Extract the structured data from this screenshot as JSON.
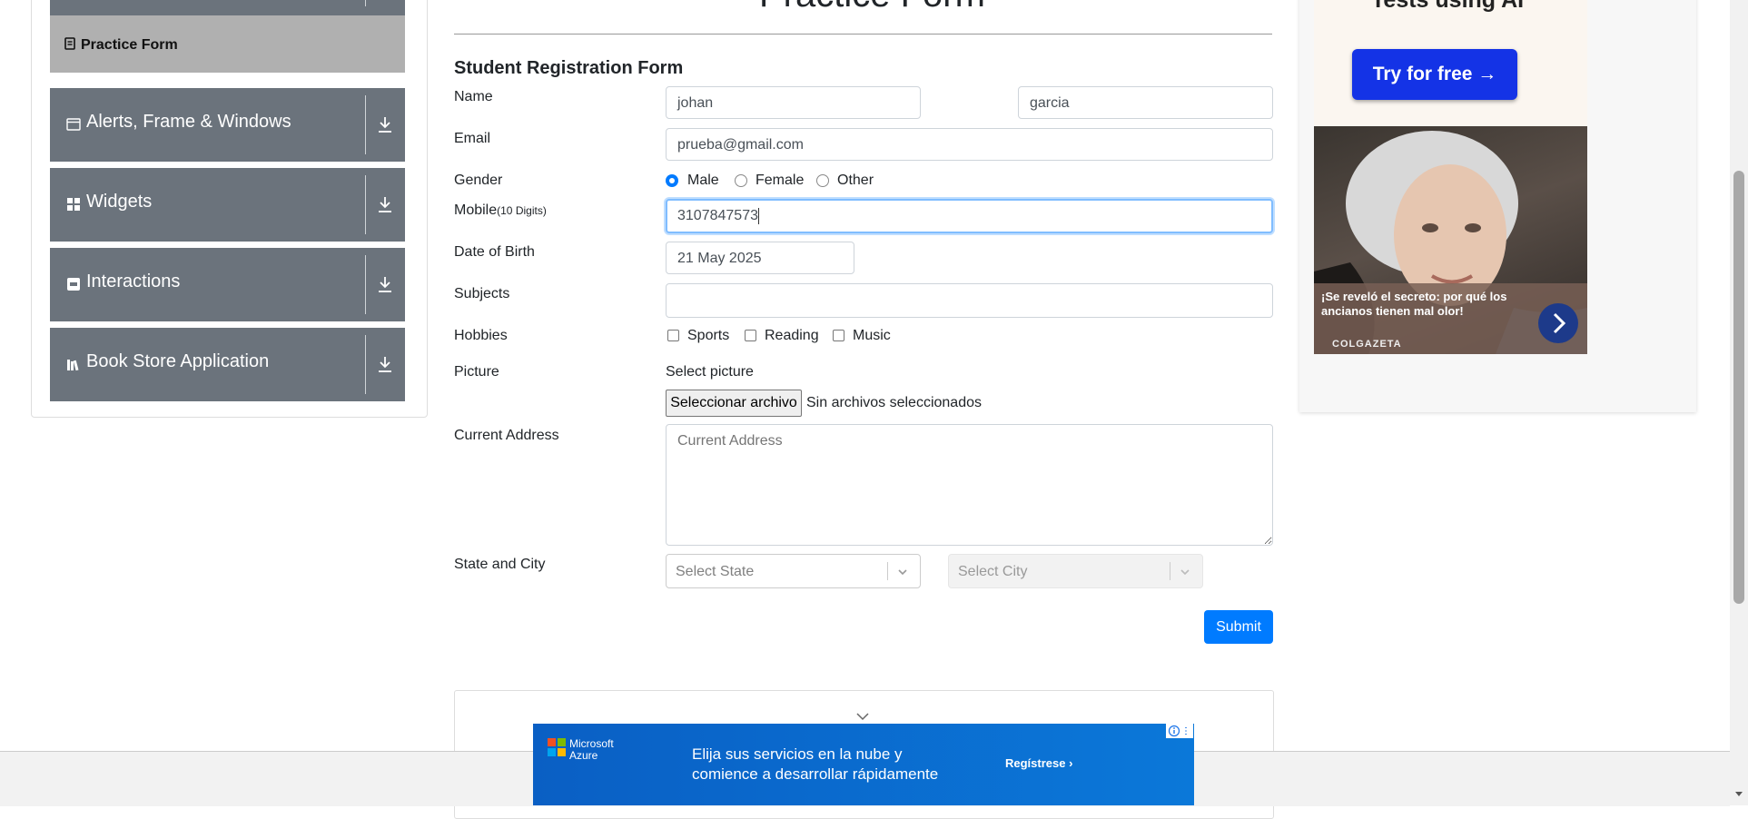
{
  "page": {
    "heading": "Practice Form"
  },
  "sidebar": {
    "active_item": "Practice Form",
    "groups": [
      {
        "label": "Alerts, Frame & Windows",
        "icon": "window-icon"
      },
      {
        "label": "Widgets",
        "icon": "widgets-icon"
      },
      {
        "label": "Interactions",
        "icon": "interactions-icon"
      },
      {
        "label": "Book Store Application",
        "icon": "books-icon"
      }
    ]
  },
  "form": {
    "title": "Student Registration Form",
    "labels": {
      "name": "Name",
      "email": "Email",
      "gender": "Gender",
      "mobile": "Mobile",
      "mobile_hint": "(10 Digits)",
      "dob": "Date of Birth",
      "subjects": "Subjects",
      "hobbies": "Hobbies",
      "picture": "Picture",
      "address": "Current Address",
      "state_city": "State and City"
    },
    "first_name": "johan",
    "last_name": "garcia",
    "email": "prueba@gmail.com",
    "gender_options": [
      "Male",
      "Female",
      "Other"
    ],
    "gender_selected": "Male",
    "mobile": "3107847573",
    "dob": "21 May 2025",
    "subjects": "",
    "hobby_options": [
      "Sports",
      "Reading",
      "Music"
    ],
    "picture_label": "Select picture",
    "file_button": "Seleccionar archivo",
    "file_status": "Sin archivos seleccionados",
    "address_placeholder": "Current Address",
    "state_placeholder": "Select State",
    "city_placeholder": "Select City",
    "submit": "Submit"
  },
  "side_ad": {
    "headline": "Tests using AI",
    "cta": "Try for free →",
    "caption": "¡Se reveló el secreto: por qué los ancianos tienen mal olor!",
    "brand": "COLGAZETA"
  },
  "bottom_ad": {
    "brand_line1": "Microsoft",
    "brand_line2": "Azure",
    "text_line1": "Elija sus servicios en la nube y",
    "text_line2": "comience a desarrollar rápidamente",
    "cta": "Regístrese ›"
  }
}
